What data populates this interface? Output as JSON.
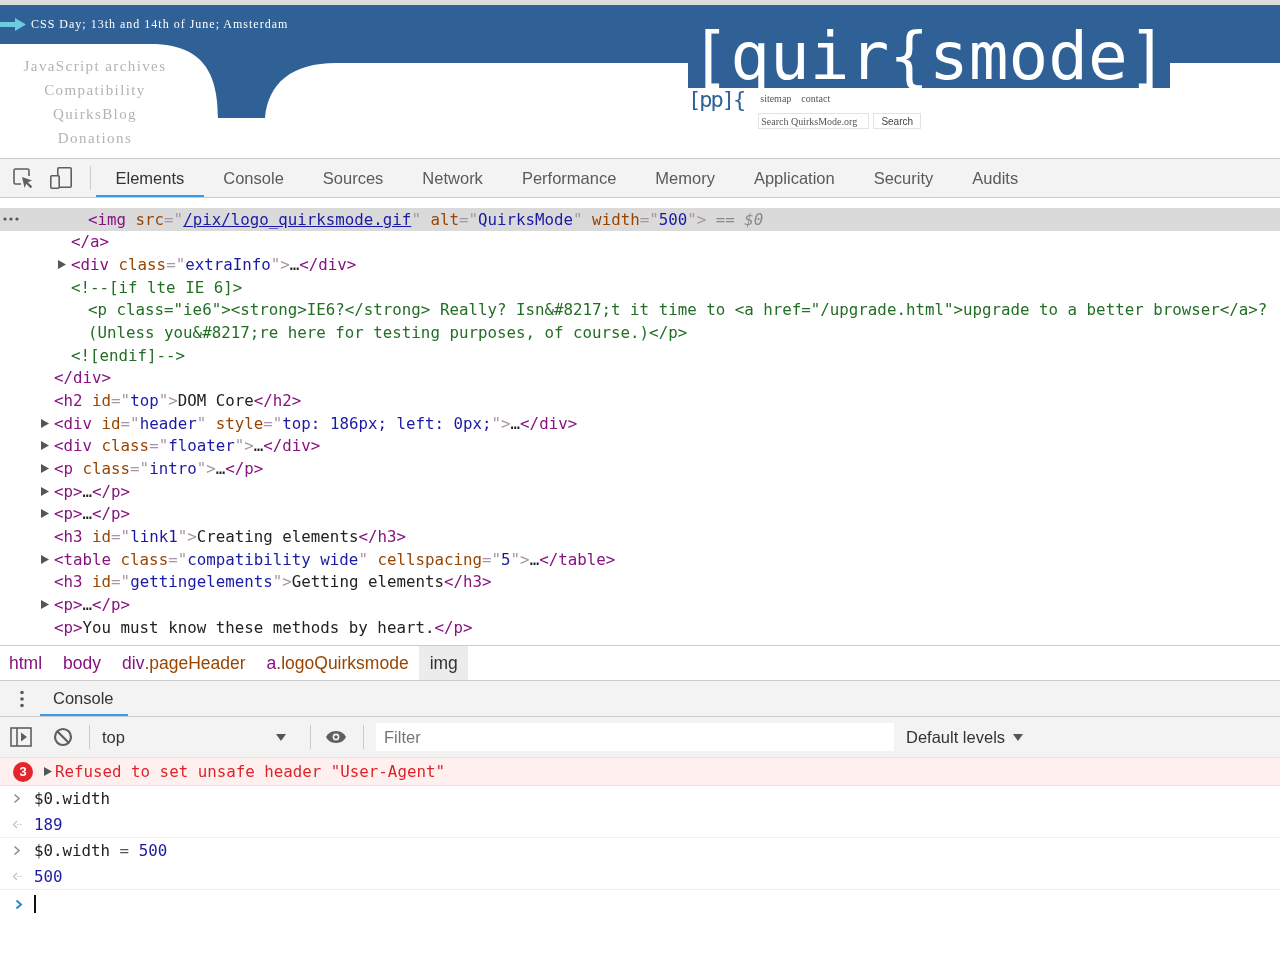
{
  "page": {
    "announcement": "CSS Day; 13th and 14th of June; Amsterdam",
    "nav": [
      "JavaScript archives",
      "Compatibility",
      "QuirksBlog",
      "Donations"
    ],
    "logo": "[quir{smode]",
    "logo_fragment": "[pp]{",
    "links": [
      "sitemap",
      "contact"
    ],
    "search": {
      "placeholder": "Search QuirksMode.org",
      "button": "Search"
    }
  },
  "devtools": {
    "tabs": [
      {
        "label": "Elements",
        "selected": true
      },
      {
        "label": "Console",
        "selected": false
      },
      {
        "label": "Sources",
        "selected": false
      },
      {
        "label": "Network",
        "selected": false
      },
      {
        "label": "Performance",
        "selected": false
      },
      {
        "label": "Memory",
        "selected": false
      },
      {
        "label": "Application",
        "selected": false
      },
      {
        "label": "Security",
        "selected": false
      },
      {
        "label": "Audits",
        "selected": false
      }
    ],
    "elements": {
      "tree": [
        {
          "kind": "open",
          "selected": false,
          "children": [
            {
              "kind": "open",
              "selected": false,
              "children": [
                {
                  "kind": "leaf",
                  "selected": true,
                  "line": [
                    {
                      "kind": "tag",
                      "text": "<img"
                    },
                    {
                      "kind": "attr",
                      "text": " src"
                    },
                    {
                      "kind": "punct",
                      "text": "=\""
                    },
                    {
                      "kind": "link",
                      "text": "/pix/logo_quirksmode.gif"
                    },
                    {
                      "kind": "punct",
                      "text": "\""
                    },
                    {
                      "kind": "attr",
                      "text": " alt"
                    },
                    {
                      "kind": "punct",
                      "text": "=\""
                    },
                    {
                      "kind": "value",
                      "text": "QuirksMode"
                    },
                    {
                      "kind": "punct",
                      "text": "\""
                    },
                    {
                      "kind": "attr",
                      "text": " width"
                    },
                    {
                      "kind": "punct",
                      "text": "=\""
                    },
                    {
                      "kind": "value",
                      "text": "500"
                    },
                    {
                      "kind": "punct",
                      "text": "\">"
                    },
                    {
                      "kind": "note",
                      "text": " == $0"
                    }
                  ]
                }
              ],
              "closing": [
                {
                  "kind": "tag",
                  "text": "</a>"
                }
              ]
            },
            {
              "kind": "collapsed",
              "selected": false,
              "line": [
                {
                  "kind": "tag",
                  "text": "<div"
                },
                {
                  "kind": "attr",
                  "text": " class"
                },
                {
                  "kind": "punct",
                  "text": "=\""
                },
                {
                  "kind": "value",
                  "text": "extraInfo"
                },
                {
                  "kind": "punct",
                  "text": "\">"
                },
                {
                  "kind": "text",
                  "text": "…"
                },
                {
                  "kind": "tag",
                  "text": "</div>"
                }
              ]
            },
            {
              "kind": "open",
              "selected": false,
              "line": [
                {
                  "kind": "comment",
                  "text": "<!--[if lte IE 6]>"
                }
              ],
              "children": [
                {
                  "kind": "leaf",
                  "selected": false,
                  "line": [
                    {
                      "kind": "comment",
                      "text": "<p class=\"ie6\"><strong>IE6?</strong> Really? Isn&#8217;t it time to <a href=\"/upgrade.html\">upgrade to a better browser</a>?"
                    }
                  ]
                },
                {
                  "kind": "leaf",
                  "selected": false,
                  "line": [
                    {
                      "kind": "comment",
                      "text": "(Unless you&#8217;re here for testing purposes, of course.)</p>"
                    }
                  ]
                }
              ],
              "closing": [
                {
                  "kind": "comment",
                  "text": "<![endif]-->"
                }
              ]
            }
          ],
          "closing": [
            {
              "kind": "tag",
              "text": "</div>"
            }
          ]
        },
        {
          "kind": "leaf",
          "selected": false,
          "line": [
            {
              "kind": "tag",
              "text": "<h2"
            },
            {
              "kind": "attr",
              "text": " id"
            },
            {
              "kind": "punct",
              "text": "=\""
            },
            {
              "kind": "value",
              "text": "top"
            },
            {
              "kind": "punct",
              "text": "\">"
            },
            {
              "kind": "text",
              "text": "DOM Core"
            },
            {
              "kind": "tag",
              "text": "</h2>"
            }
          ]
        },
        {
          "kind": "collapsed",
          "selected": false,
          "line": [
            {
              "kind": "tag",
              "text": "<div"
            },
            {
              "kind": "attr",
              "text": " id"
            },
            {
              "kind": "punct",
              "text": "=\""
            },
            {
              "kind": "value",
              "text": "header"
            },
            {
              "kind": "punct",
              "text": "\""
            },
            {
              "kind": "attr",
              "text": " style"
            },
            {
              "kind": "punct",
              "text": "=\""
            },
            {
              "kind": "value",
              "text": "top: 186px; left: 0px;"
            },
            {
              "kind": "punct",
              "text": "\">"
            },
            {
              "kind": "text",
              "text": "…"
            },
            {
              "kind": "tag",
              "text": "</div>"
            }
          ]
        },
        {
          "kind": "collapsed",
          "selected": false,
          "line": [
            {
              "kind": "tag",
              "text": "<div"
            },
            {
              "kind": "attr",
              "text": " class"
            },
            {
              "kind": "punct",
              "text": "=\""
            },
            {
              "kind": "value",
              "text": "floater"
            },
            {
              "kind": "punct",
              "text": "\">"
            },
            {
              "kind": "text",
              "text": "…"
            },
            {
              "kind": "tag",
              "text": "</div>"
            }
          ]
        },
        {
          "kind": "collapsed",
          "selected": false,
          "line": [
            {
              "kind": "tag",
              "text": "<p"
            },
            {
              "kind": "attr",
              "text": " class"
            },
            {
              "kind": "punct",
              "text": "=\""
            },
            {
              "kind": "value",
              "text": "intro"
            },
            {
              "kind": "punct",
              "text": "\">"
            },
            {
              "kind": "text",
              "text": "…"
            },
            {
              "kind": "tag",
              "text": "</p>"
            }
          ]
        },
        {
          "kind": "collapsed",
          "selected": false,
          "line": [
            {
              "kind": "tag",
              "text": "<p>"
            },
            {
              "kind": "text",
              "text": "…"
            },
            {
              "kind": "tag",
              "text": "</p>"
            }
          ]
        },
        {
          "kind": "collapsed",
          "selected": false,
          "line": [
            {
              "kind": "tag",
              "text": "<p>"
            },
            {
              "kind": "text",
              "text": "…"
            },
            {
              "kind": "tag",
              "text": "</p>"
            }
          ]
        },
        {
          "kind": "leaf",
          "selected": false,
          "line": [
            {
              "kind": "tag",
              "text": "<h3"
            },
            {
              "kind": "attr",
              "text": " id"
            },
            {
              "kind": "punct",
              "text": "=\""
            },
            {
              "kind": "value",
              "text": "link1"
            },
            {
              "kind": "punct",
              "text": "\">"
            },
            {
              "kind": "text",
              "text": "Creating elements"
            },
            {
              "kind": "tag",
              "text": "</h3>"
            }
          ]
        },
        {
          "kind": "collapsed",
          "selected": false,
          "line": [
            {
              "kind": "tag",
              "text": "<table"
            },
            {
              "kind": "attr",
              "text": " class"
            },
            {
              "kind": "punct",
              "text": "=\""
            },
            {
              "kind": "value",
              "text": "compatibility wide"
            },
            {
              "kind": "punct",
              "text": "\""
            },
            {
              "kind": "attr",
              "text": " cellspacing"
            },
            {
              "kind": "punct",
              "text": "=\""
            },
            {
              "kind": "value",
              "text": "5"
            },
            {
              "kind": "punct",
              "text": "\">"
            },
            {
              "kind": "text",
              "text": "…"
            },
            {
              "kind": "tag",
              "text": "</table>"
            }
          ]
        },
        {
          "kind": "leaf",
          "selected": false,
          "line": [
            {
              "kind": "tag",
              "text": "<h3"
            },
            {
              "kind": "attr",
              "text": " id"
            },
            {
              "kind": "punct",
              "text": "=\""
            },
            {
              "kind": "value",
              "text": "gettingelements"
            },
            {
              "kind": "punct",
              "text": "\">"
            },
            {
              "kind": "text",
              "text": "Getting elements"
            },
            {
              "kind": "tag",
              "text": "</h3>"
            }
          ]
        },
        {
          "kind": "collapsed",
          "selected": false,
          "line": [
            {
              "kind": "tag",
              "text": "<p>"
            },
            {
              "kind": "text",
              "text": "…"
            },
            {
              "kind": "tag",
              "text": "</p>"
            }
          ]
        },
        {
          "kind": "leaf",
          "selected": false,
          "line": [
            {
              "kind": "tag",
              "text": "<p>"
            },
            {
              "kind": "text",
              "text": "You must know these methods by heart."
            },
            {
              "kind": "tag",
              "text": "</p>"
            }
          ]
        }
      ]
    },
    "breadcrumbs": [
      {
        "tag": "html",
        "selected": false
      },
      {
        "tag": "body",
        "selected": false
      },
      {
        "tag": "div",
        "class": ".pageHeader",
        "selected": false
      },
      {
        "tag": "a",
        "class": ".logoQuirksmode",
        "selected": false
      },
      {
        "tag": "img",
        "selected": true
      }
    ],
    "drawer_tabs": [
      {
        "label": "Console",
        "selected": true
      }
    ],
    "console_toolbar": {
      "context": "top",
      "filter_placeholder": "Filter",
      "levels": "Default levels"
    },
    "console": [
      {
        "kind": "error",
        "count": "3",
        "expanded": false,
        "text": "Refused to set unsafe header \"User-Agent\""
      },
      {
        "kind": "evaluation",
        "input": [
          {
            "kind": "code",
            "text": "$0.width"
          }
        ],
        "result": "189"
      },
      {
        "kind": "evaluation",
        "input": [
          {
            "kind": "code",
            "text": "$0.width"
          },
          {
            "kind": "operator",
            "text": " = "
          },
          {
            "kind": "number",
            "text": "500"
          }
        ],
        "result": "500"
      },
      {
        "kind": "prompt"
      }
    ]
  }
}
